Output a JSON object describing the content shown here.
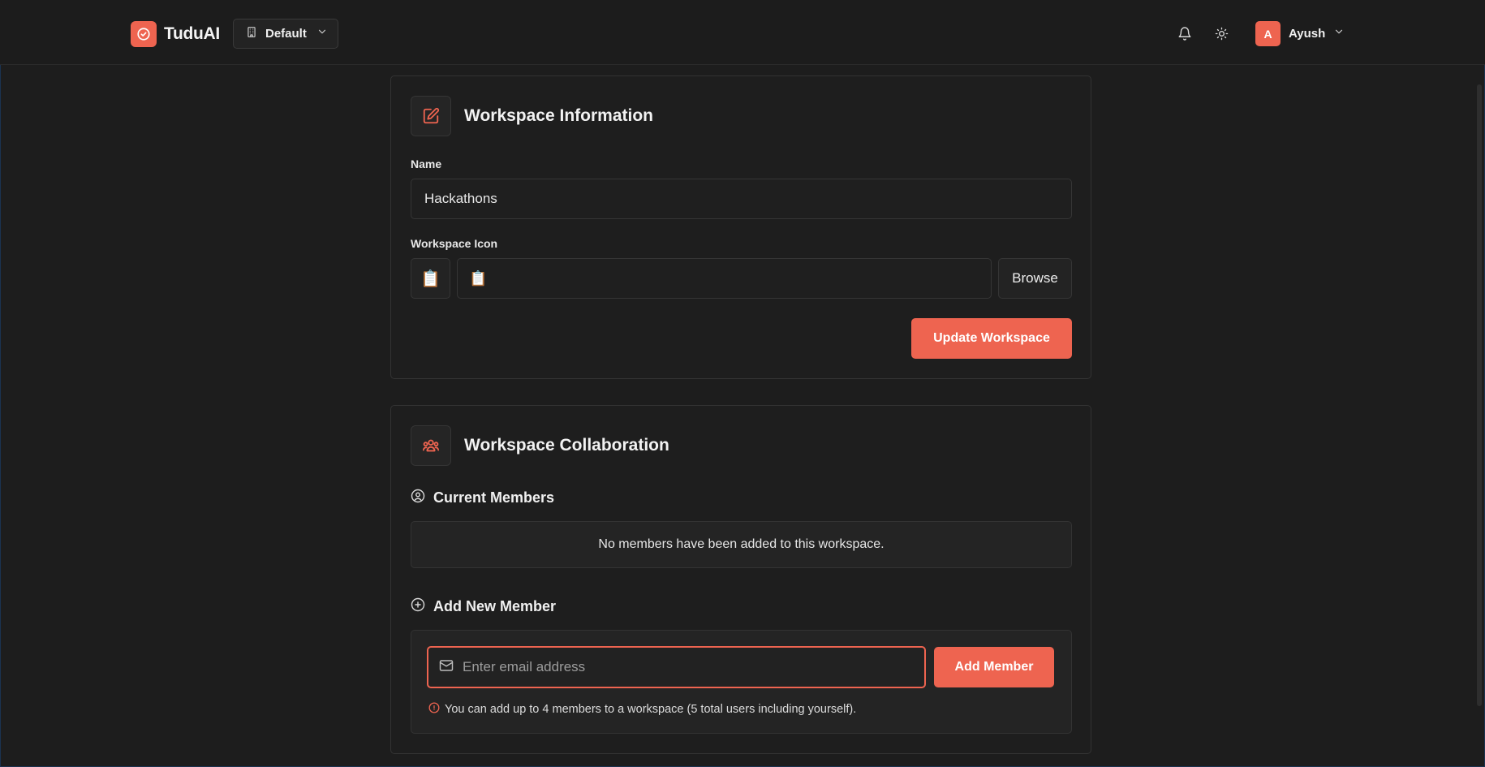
{
  "app": {
    "name": "TuduAI"
  },
  "header": {
    "workspace_selector": {
      "label": "Default"
    },
    "user": {
      "initial": "A",
      "name": "Ayush"
    }
  },
  "workspace_info": {
    "title": "Workspace Information",
    "name_label": "Name",
    "name_value": "Hackathons",
    "icon_label": "Workspace Icon",
    "icon_preview": "📋",
    "icon_value": "📋",
    "browse_label": "Browse",
    "update_button": "Update Workspace"
  },
  "collaboration": {
    "title": "Workspace Collaboration",
    "current_members": {
      "heading": "Current Members",
      "empty_text": "No members have been added to this workspace."
    },
    "add_member": {
      "heading": "Add New Member",
      "email_placeholder": "Enter email address",
      "button": "Add Member",
      "hint": "You can add up to 4 members to a workspace (5 total users including yourself)."
    }
  },
  "colors": {
    "accent": "#ee6450",
    "background": "#1d1d1d",
    "card_border": "#333333"
  },
  "icons": {
    "logo": "check-circle-icon",
    "workspace_selector": "building-icon",
    "notifications": "bell-icon",
    "theme": "sun-icon",
    "edit": "pencil-square-icon",
    "team": "users-icon",
    "members": "user-circle-icon",
    "add": "plus-circle-icon",
    "email": "mail-icon",
    "hint": "info-icon"
  }
}
